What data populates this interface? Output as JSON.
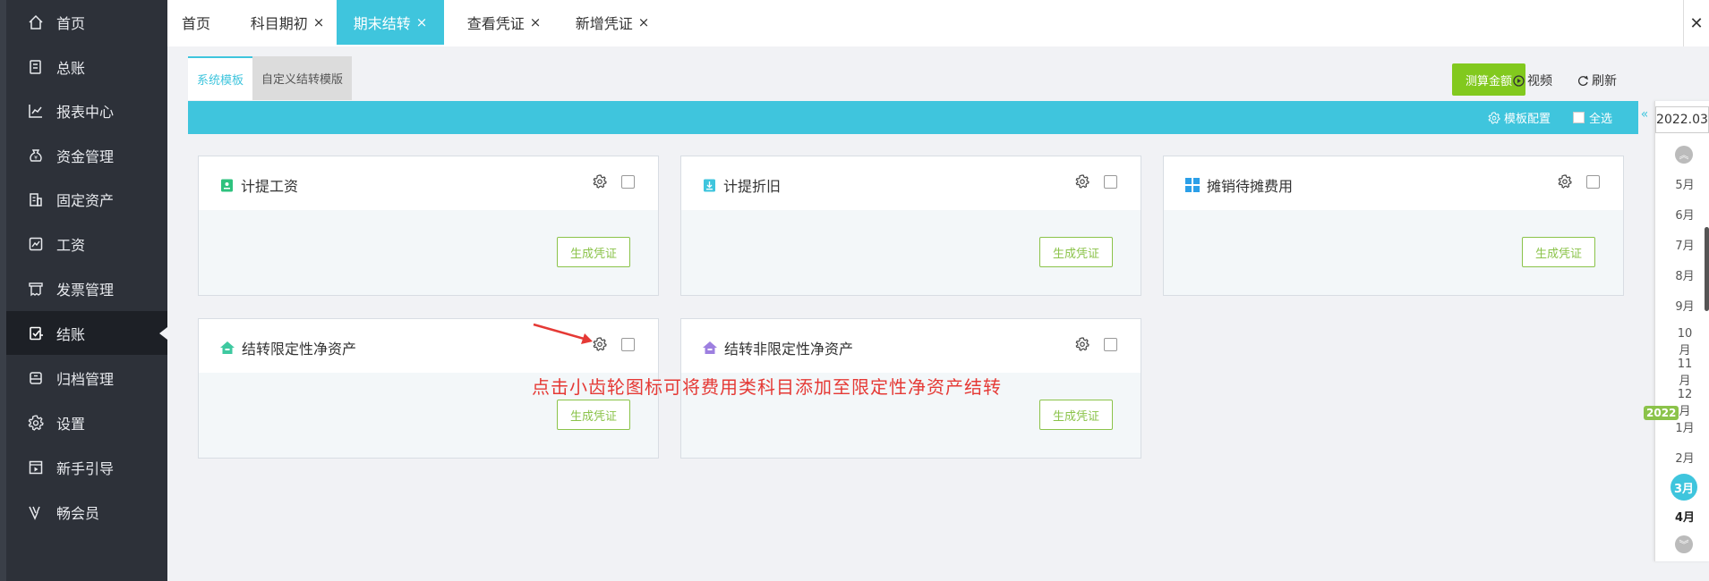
{
  "sidebar": {
    "items": [
      {
        "label": "首页",
        "icon": "home-icon"
      },
      {
        "label": "总账",
        "icon": "ledger-icon"
      },
      {
        "label": "报表中心",
        "icon": "chart-icon"
      },
      {
        "label": "资金管理",
        "icon": "money-bag-icon"
      },
      {
        "label": "固定资产",
        "icon": "building-icon"
      },
      {
        "label": "工资",
        "icon": "salary-icon"
      },
      {
        "label": "发票管理",
        "icon": "invoice-icon"
      },
      {
        "label": "结账",
        "icon": "checkout-icon"
      },
      {
        "label": "归档管理",
        "icon": "archive-icon"
      },
      {
        "label": "设置",
        "icon": "gear-icon"
      },
      {
        "label": "新手引导",
        "icon": "play-guide-icon"
      },
      {
        "label": "畅会员",
        "icon": "vip-icon"
      }
    ],
    "active_index": 7
  },
  "tabs": [
    {
      "label": "首页",
      "closable": false
    },
    {
      "label": "科目期初",
      "closable": true
    },
    {
      "label": "期末结转",
      "closable": true
    },
    {
      "label": "查看凭证",
      "closable": true
    },
    {
      "label": "新增凭证",
      "closable": true
    }
  ],
  "tab_close_glyph": "×",
  "close_all_glyph": "✕",
  "subtabs": {
    "system": "系统模板",
    "custom": "自定义结转模版"
  },
  "toolbar": {
    "calc": "测算金额",
    "video": "视频",
    "refresh": "刷新"
  },
  "bluebar": {
    "config": "模板配置",
    "select_all": "全选"
  },
  "cards": [
    {
      "title": "计提工资",
      "icon": "salary-doc-icon",
      "icon_color": "#2ec27e",
      "button": "生成凭证"
    },
    {
      "title": "计提折旧",
      "icon": "depreciation-doc-icon",
      "icon_color": "#3fc5dd",
      "button": "生成凭证"
    },
    {
      "title": "摊销待摊费用",
      "icon": "grid-icon",
      "icon_color": "#2b9fe8",
      "button": "生成凭证"
    },
    {
      "title": "结转限定性净资产",
      "icon": "house-icon",
      "icon_color": "#3ec9a0",
      "button": "生成凭证"
    },
    {
      "title": "结转非限定性净资产",
      "icon": "house-icon",
      "icon_color": "#9d7fe0",
      "button": "生成凭证"
    }
  ],
  "annotation": "点击小齿轮图标可将费用类科目添加至限定性净资产结转",
  "period_panel": {
    "current_period": "2022.03",
    "months": [
      "5月",
      "6月",
      "7月",
      "8月",
      "9月",
      "10月",
      "11月",
      "12月",
      "1月",
      "2月",
      "3月",
      "4月"
    ],
    "year_badge": "2022",
    "current_month_index": 10
  },
  "colors": {
    "accent": "#3fc5dd",
    "green": "#82c91e",
    "sidebar": "#2d3139",
    "annotation": "#e53935"
  }
}
